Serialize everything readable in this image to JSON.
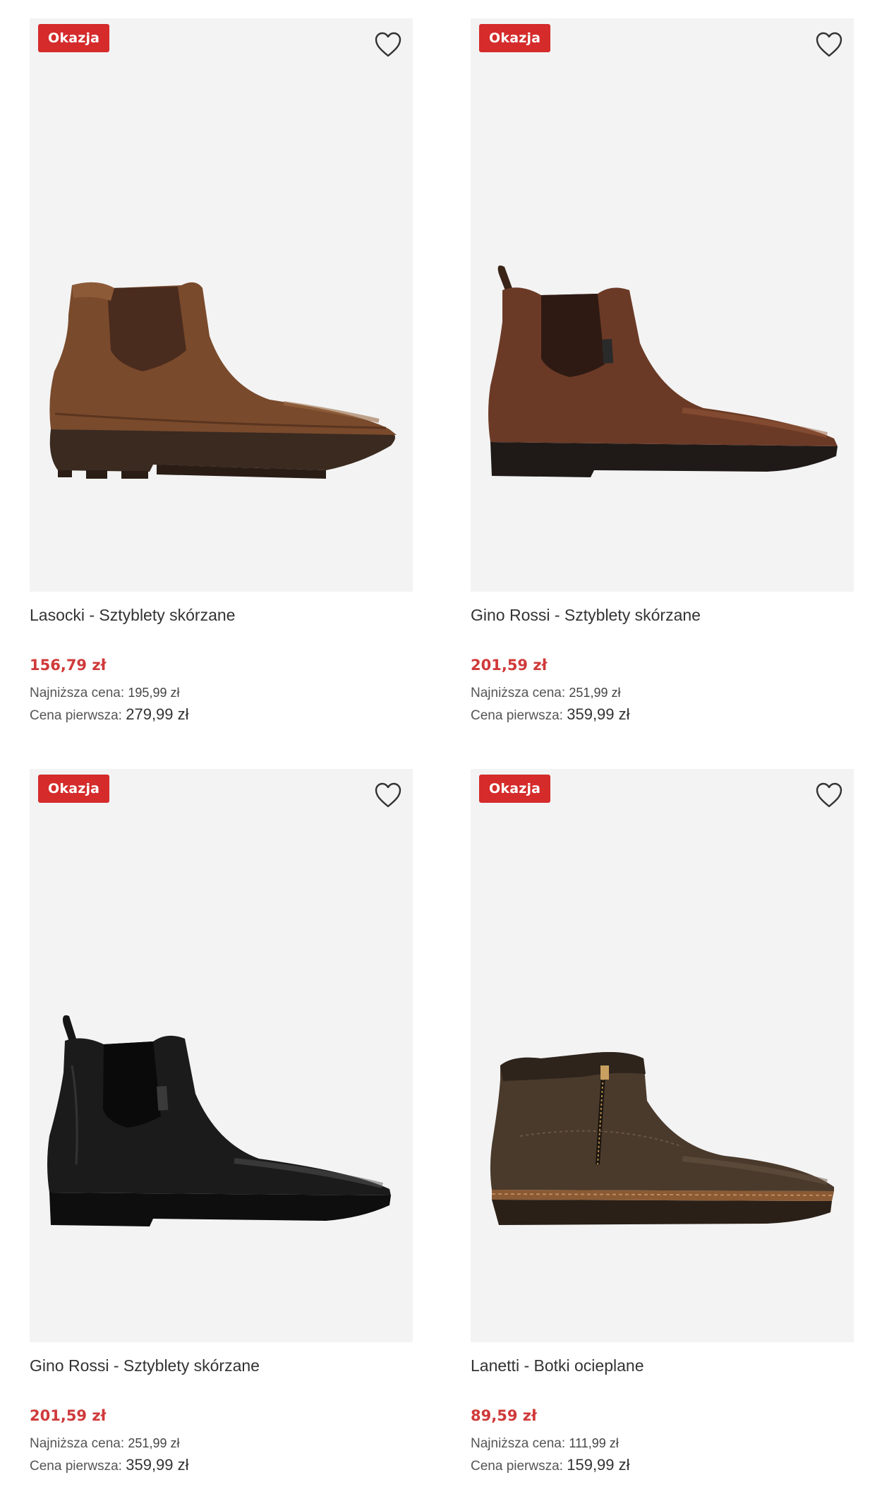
{
  "products": [
    {
      "badge": "Okazja",
      "image_icon": "brown-chelsea-boot",
      "title": "Lasocki - Sztyblety skórzane",
      "price": "156,79 zł",
      "lowest_label": "Najniższa cena:",
      "lowest_value": "195,99 zł",
      "first_label": "Cena pierwsza:",
      "first_value": "279,99 zł"
    },
    {
      "badge": "Okazja",
      "image_icon": "brown-leather-chelsea-boot",
      "title": "Gino Rossi - Sztyblety skórzane",
      "price": "201,59 zł",
      "lowest_label": "Najniższa cena:",
      "lowest_value": "251,99 zł",
      "first_label": "Cena pierwsza:",
      "first_value": "359,99 zł"
    },
    {
      "badge": "Okazja",
      "image_icon": "black-leather-chelsea-boot",
      "title": "Gino Rossi - Sztyblety skórzane",
      "price": "201,59 zł",
      "lowest_label": "Najniższa cena:",
      "lowest_value": "251,99 zł",
      "first_label": "Cena pierwsza:",
      "first_value": "359,99 zł"
    },
    {
      "badge": "Okazja",
      "image_icon": "dark-brown-zip-boot",
      "title": "Lanetti - Botki ocieplane",
      "price": "89,59 zł",
      "lowest_label": "Najniższa cena:",
      "lowest_value": "111,99 zł",
      "first_label": "Cena pierwsza:",
      "first_value": "159,99 zł"
    }
  ],
  "colors": {
    "badge_bg": "#d52b2b",
    "price": "#d03a3a",
    "image_bg": "#f3f3f3"
  }
}
